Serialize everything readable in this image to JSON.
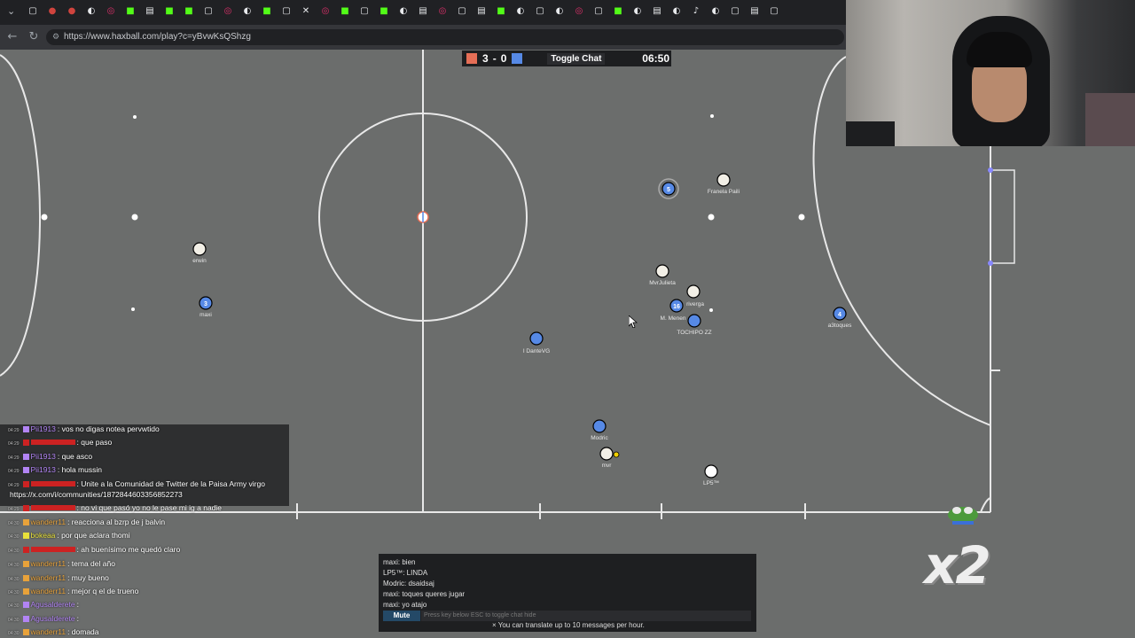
{
  "browser": {
    "url": "https://www.haxball.com/play?c=yBvwKsQShzg"
  },
  "scoreboard": {
    "red_score": "3",
    "separator": "-",
    "blue_score": "0",
    "toggle_chat_label": "Toggle Chat",
    "time": "06:50",
    "red_color": "#e56e56",
    "blue_color": "#5689e5"
  },
  "players": [
    {
      "team": "blue",
      "number": "5",
      "name": ""
    },
    {
      "team": "red",
      "number": "",
      "name": "Franela Paili"
    },
    {
      "team": "red",
      "number": "",
      "name": "erwin"
    },
    {
      "team": "blue",
      "number": "3",
      "name": "maxi"
    },
    {
      "team": "red",
      "number": "",
      "name": "MvrJulieta"
    },
    {
      "team": "red",
      "number": "",
      "name": "riverga"
    },
    {
      "team": "blue",
      "number": "16",
      "name": "M. Menen"
    },
    {
      "team": "blue",
      "number": "",
      "name": "TOCHIPO ZZ"
    },
    {
      "team": "blue",
      "number": "4",
      "name": "a3toques"
    },
    {
      "team": "blue",
      "number": "",
      "name": "I DanteVG"
    },
    {
      "team": "blue",
      "number": "",
      "name": "Modric"
    },
    {
      "team": "red",
      "number": "",
      "name": "mvr"
    },
    {
      "team": "red",
      "number": "",
      "name": "LP5™"
    }
  ],
  "stream_chat": [
    {
      "time": "04:29",
      "user": "Pii1913",
      "user_color": "#b284f5",
      "text": ": vos no digas notea pervwtido"
    },
    {
      "time": "04:29",
      "user": "",
      "user_color": "#cc2222",
      "text": ": que paso"
    },
    {
      "time": "04:29",
      "user": "Pii1913",
      "user_color": "#b284f5",
      "text": ": que asco"
    },
    {
      "time": "04:29",
      "user": "Pii1913",
      "user_color": "#b284f5",
      "text": ": hola mussin"
    },
    {
      "time": "04:29",
      "user": "",
      "user_color": "#cc2222",
      "text": ": Unite a la Comunidad de Twitter de la Paisa Army virgo"
    },
    {
      "time": "",
      "user": "",
      "user_color": "#ffffff",
      "text": "https://x.com/i/communities/1872844603356852273"
    },
    {
      "time": "04:29",
      "user": "",
      "user_color": "#cc2222",
      "text": ": no vi que pasó yo no le pase mi ig a nadie"
    },
    {
      "time": "04:30",
      "user": "wanderr11",
      "user_color": "#e8a23a",
      "text": ": reacciona al bzrp de j balvin"
    },
    {
      "time": "04:30",
      "user": "bokeaa",
      "user_color": "#e8e13a",
      "text": ": por que aclara thomi"
    },
    {
      "time": "04:30",
      "user": "",
      "user_color": "#cc2222",
      "text": ": ah buenísimo me quedó claro"
    },
    {
      "time": "04:30",
      "user": "wanderr11",
      "user_color": "#e8a23a",
      "text": ": tema del año"
    },
    {
      "time": "04:30",
      "user": "wanderr11",
      "user_color": "#e8a23a",
      "text": ": muy bueno"
    },
    {
      "time": "04:30",
      "user": "wanderr11",
      "user_color": "#e8a23a",
      "text": ": mejor q el de trueno"
    },
    {
      "time": "04:30",
      "user": "Agusalderete",
      "user_color": "#b284f5",
      "text": ":"
    },
    {
      "time": "04:30",
      "user": "Agusalderete",
      "user_color": "#b284f5",
      "text": ":"
    },
    {
      "time": "04:30",
      "user": "wanderr11",
      "user_color": "#e8a23a",
      "text": ": domada"
    }
  ],
  "game_chat": {
    "messages": [
      "maxi: bien",
      "LP5™: LINDA",
      "Modric: dsaidsaj",
      "maxi: toques queres jugar",
      "maxi: yo atajo"
    ],
    "mute_label": "Mute",
    "input_placeholder": "Press key below ESC to toggle chat hide",
    "translate_note": "× You can translate up to 10 messages per hour."
  },
  "overlay": {
    "multiplier": "x2"
  }
}
